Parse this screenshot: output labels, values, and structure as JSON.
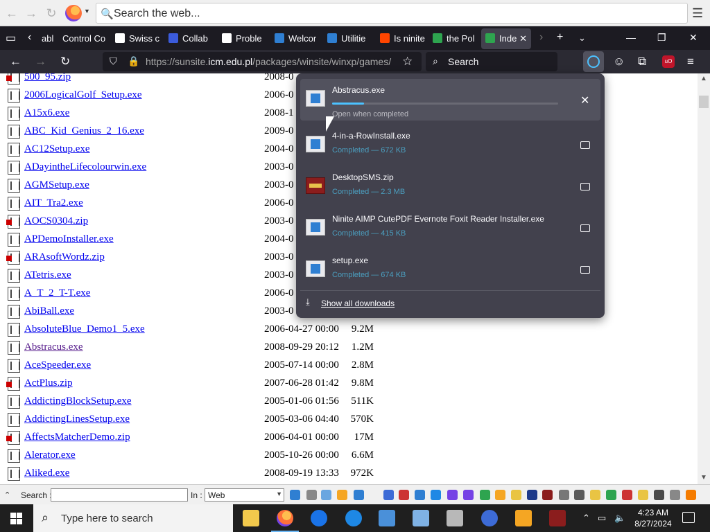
{
  "top_toolbar": {
    "search_placeholder": "Search the web..."
  },
  "tabs": [
    {
      "label": "abl",
      "color": "#888888"
    },
    {
      "label": "Control Co",
      "color": "#888888"
    },
    {
      "label": "Swiss c",
      "color": "#ffffff"
    },
    {
      "label": "Collab",
      "color": "#3b5bdb"
    },
    {
      "label": "Proble",
      "color": "#ffffff"
    },
    {
      "label": "Welcor",
      "color": "#2f7fd2"
    },
    {
      "label": "Utilitie",
      "color": "#2f7fd2"
    },
    {
      "label": "Is ninite",
      "color": "#ff4500"
    },
    {
      "label": "the Pol",
      "color": "#2ea44f"
    },
    {
      "label": "Inde",
      "color": "#2ea44f"
    }
  ],
  "navbar": {
    "url_prefix": "https://sunsite.",
    "url_host": "icm.edu.pl",
    "url_path": "/packages/winsite/winxp/games/",
    "search_placeholder": "Search"
  },
  "files": [
    {
      "name": "500_95.zip",
      "date": "2008-0",
      "size": "",
      "type": "zip",
      "visited": false
    },
    {
      "name": "2006LogicalGolf_Setup.exe",
      "date": "2006-0",
      "size": "",
      "type": "exe",
      "visited": false
    },
    {
      "name": "A15x6.exe",
      "date": "2008-1",
      "size": "",
      "type": "exe",
      "visited": false
    },
    {
      "name": "ABC_Kid_Genius_2_16.exe",
      "date": "2009-0",
      "size": "",
      "type": "exe",
      "visited": false
    },
    {
      "name": "AC12Setup.exe",
      "date": "2004-0",
      "size": "",
      "type": "exe",
      "visited": false
    },
    {
      "name": "ADayintheLifecolourwin.exe",
      "date": "2003-0",
      "size": "",
      "type": "exe",
      "visited": false
    },
    {
      "name": "AGMSetup.exe",
      "date": "2003-0",
      "size": "",
      "type": "exe",
      "visited": false
    },
    {
      "name": "AIT_Tra2.exe",
      "date": "2006-0",
      "size": "",
      "type": "exe",
      "visited": false
    },
    {
      "name": "AOCS0304.zip",
      "date": "2003-0",
      "size": "",
      "type": "zip",
      "visited": false
    },
    {
      "name": "APDemoInstaller.exe",
      "date": "2004-0",
      "size": "",
      "type": "exe",
      "visited": false
    },
    {
      "name": "ARAsoftWordz.zip",
      "date": "2003-0",
      "size": "",
      "type": "zip",
      "visited": false
    },
    {
      "name": "ATetris.exe",
      "date": "2003-0",
      "size": "",
      "type": "exe",
      "visited": false
    },
    {
      "name": "A_T_2_T-T.exe",
      "date": "2006-0",
      "size": "",
      "type": "exe",
      "visited": false
    },
    {
      "name": "AbiBall.exe",
      "date": "2003-0",
      "size": "",
      "type": "exe",
      "visited": false
    },
    {
      "name": "AbsoluteBlue_Demo1_5.exe",
      "date": "2006-04-27 00:00",
      "size": "9.2M",
      "type": "exe",
      "visited": false
    },
    {
      "name": "Abstracus.exe",
      "date": "2008-09-29 20:12",
      "size": "1.2M",
      "type": "exe",
      "visited": true
    },
    {
      "name": "AceSpeeder.exe",
      "date": "2005-07-14 00:00",
      "size": "2.8M",
      "type": "exe",
      "visited": false
    },
    {
      "name": "ActPlus.zip",
      "date": "2007-06-28 01:42",
      "size": "9.8M",
      "type": "zip",
      "visited": false
    },
    {
      "name": "AddictingBlockSetup.exe",
      "date": "2005-01-06 01:56",
      "size": "511K",
      "type": "exe",
      "visited": false
    },
    {
      "name": "AddictingLinesSetup.exe",
      "date": "2005-03-06 04:40",
      "size": "570K",
      "type": "exe",
      "visited": false
    },
    {
      "name": "AffectsMatcherDemo.zip",
      "date": "2006-04-01 00:00",
      "size": "17M",
      "type": "zip",
      "visited": false
    },
    {
      "name": "Alerator.exe",
      "date": "2005-10-26 00:00",
      "size": "6.6M",
      "type": "exe",
      "visited": false
    },
    {
      "name": "Aliked.exe",
      "date": "2008-09-19 13:33",
      "size": "972K",
      "type": "exe",
      "visited": false
    }
  ],
  "downloads": [
    {
      "name": "Abstracus.exe",
      "status": "Open when completed",
      "progress": 0.14,
      "in_progress": true,
      "icon": "installer"
    },
    {
      "name": "4-in-a-RowInstall.exe",
      "status": "Completed — 672 KB",
      "in_progress": false,
      "icon": "installer"
    },
    {
      "name": "DesktopSMS.zip",
      "status": "Completed — 2.3 MB",
      "in_progress": false,
      "icon": "winrar"
    },
    {
      "name": "Ninite AIMP CutePDF Evernote Foxit Reader Installer.exe",
      "status": "Completed — 415 KB",
      "in_progress": false,
      "icon": "installer"
    },
    {
      "name": "setup.exe",
      "status": "Completed — 674 KB",
      "in_progress": false,
      "icon": "installer"
    }
  ],
  "downloads_footer": {
    "label": "Show all downloads"
  },
  "bottom_toolbar": {
    "search_label": "Search :",
    "in_label": "In :",
    "in_value": "Web"
  },
  "taskbar": {
    "search_placeholder": "Type here to search",
    "time": "4:23 AM",
    "date": "8/27/2024"
  }
}
